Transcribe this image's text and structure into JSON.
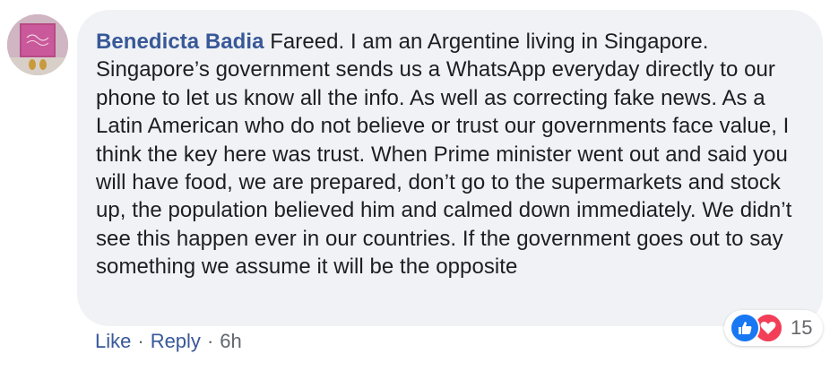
{
  "comment": {
    "author": "Benedicta Badia",
    "text": "Fareed. I am an Argentine living in Singapore. Singapore’s government sends us a WhatsApp everyday directly to our phone to let us know all the info. As well as correcting fake news. As a Latin American who do not believe or trust our governments face value, I think the key here was trust. When Prime minister went out and said you will have food, we are prepared, don’t go to the supermarkets and stock up, the population believed him and calmed down immediately. We didn’t see this happen ever in our countries. If the government goes out to say something we assume it will be the opposite",
    "avatar_icon": "profile-avatar"
  },
  "reactions": {
    "icons": [
      "like-icon",
      "love-icon"
    ],
    "count": "15",
    "like_color": "#1877f2",
    "love_color": "#f33e58"
  },
  "actions": {
    "like_label": "Like",
    "separator": "·",
    "reply_label": "Reply",
    "time": "6h"
  },
  "colors": {
    "link": "#385898",
    "bubble": "#f0f2f5",
    "text": "#1c1e21",
    "meta": "#606770"
  }
}
